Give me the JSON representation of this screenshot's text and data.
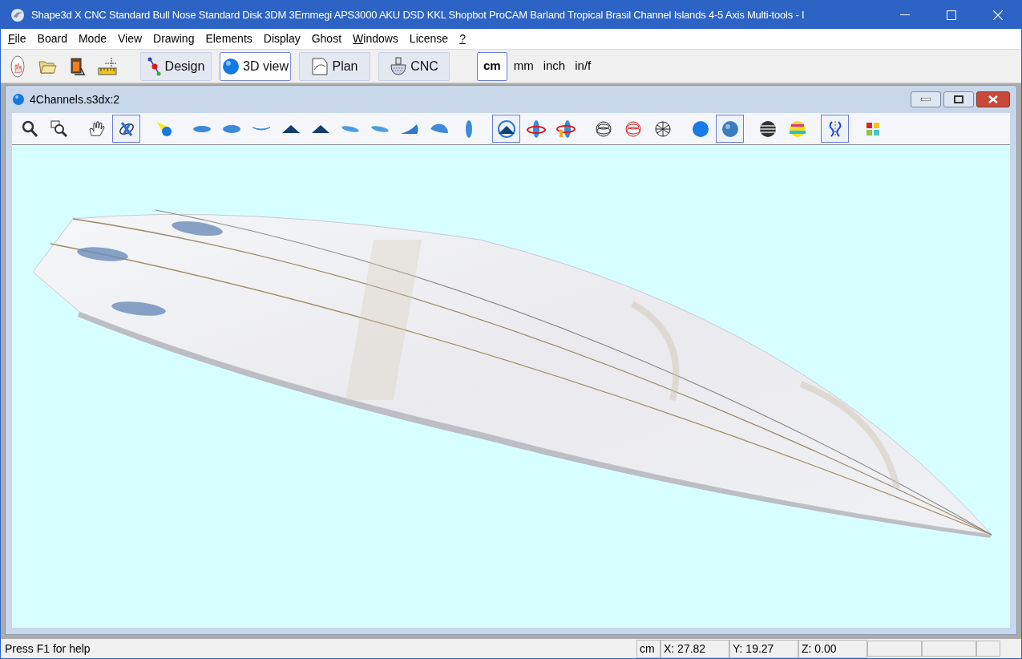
{
  "window": {
    "title": "Shape3d X CNC  Standard Bull Nose Standard Disk 3DM 3Emmegi APS3000 AKU DSD KKL Shopbot ProCAM Barland Tropical Brasil Channel Islands 4-5 Axis Multi-tools - I"
  },
  "menu": [
    {
      "label": "File",
      "underline": true
    },
    {
      "label": "Board",
      "underline": false
    },
    {
      "label": "Mode",
      "underline": false
    },
    {
      "label": "View",
      "underline": false
    },
    {
      "label": "Drawing",
      "underline": false
    },
    {
      "label": "Elements",
      "underline": false
    },
    {
      "label": "Display",
      "underline": false
    },
    {
      "label": "Ghost",
      "underline": false
    },
    {
      "label": "Windows",
      "underline": true
    },
    {
      "label": "License",
      "underline": false
    },
    {
      "label": "?",
      "underline": true
    }
  ],
  "toolbar": {
    "tools": [
      {
        "kind": "board"
      },
      {
        "kind": "folder"
      },
      {
        "kind": "export"
      },
      {
        "kind": "ruler"
      }
    ],
    "modes": [
      {
        "kind": "design",
        "label": "Design",
        "selected": false
      },
      {
        "kind": "view3d",
        "label": "3D view",
        "selected": true
      },
      {
        "kind": "plan",
        "label": "Plan",
        "selected": false
      },
      {
        "kind": "cnc",
        "label": "CNC",
        "selected": false
      }
    ],
    "units": [
      {
        "label": "cm",
        "selected": true
      },
      {
        "label": "mm",
        "selected": false
      },
      {
        "label": "inch",
        "selected": false
      },
      {
        "label": "in/f",
        "selected": false
      }
    ]
  },
  "document": {
    "title": "4Channels.s3dx:2",
    "tool_groups": [
      [
        {
          "kind": "zoom",
          "selected": false
        },
        {
          "kind": "zoom-window",
          "selected": false
        }
      ],
      [
        {
          "kind": "hand",
          "selected": false
        },
        {
          "kind": "orbit",
          "selected": true
        }
      ],
      [
        {
          "kind": "light",
          "selected": false
        }
      ],
      [
        {
          "kind": "flat",
          "selected": false
        },
        {
          "kind": "oval",
          "selected": false
        },
        {
          "kind": "curve",
          "selected": false
        },
        {
          "kind": "peak",
          "selected": false
        },
        {
          "kind": "peak",
          "selected": false
        },
        {
          "kind": "slant",
          "selected": false
        },
        {
          "kind": "slant",
          "selected": false
        },
        {
          "kind": "wedge",
          "selected": false
        },
        {
          "kind": "drop",
          "selected": false
        },
        {
          "kind": "vertical",
          "selected": false
        }
      ],
      [
        {
          "kind": "spin",
          "selected": true
        },
        {
          "kind": "rotate",
          "selected": false
        },
        {
          "kind": "rotate-up",
          "selected": false
        }
      ],
      [
        {
          "kind": "wire",
          "selected": false
        },
        {
          "kind": "wire-red",
          "selected": false
        },
        {
          "kind": "mesh",
          "selected": false
        }
      ],
      [
        {
          "kind": "sphere",
          "selected": false
        },
        {
          "kind": "textured",
          "selected": true
        }
      ],
      [
        {
          "kind": "striped",
          "selected": false
        },
        {
          "kind": "rainbow",
          "selected": false
        }
      ],
      [
        {
          "kind": "symmetry",
          "selected": true
        }
      ],
      [
        {
          "kind": "palette",
          "selected": false
        }
      ]
    ]
  },
  "status_bar": {
    "help": "Press F1 for help",
    "unit": "cm",
    "x": "X: 27.82",
    "y": "Y: 19.27",
    "z": "Z: 0.00"
  }
}
